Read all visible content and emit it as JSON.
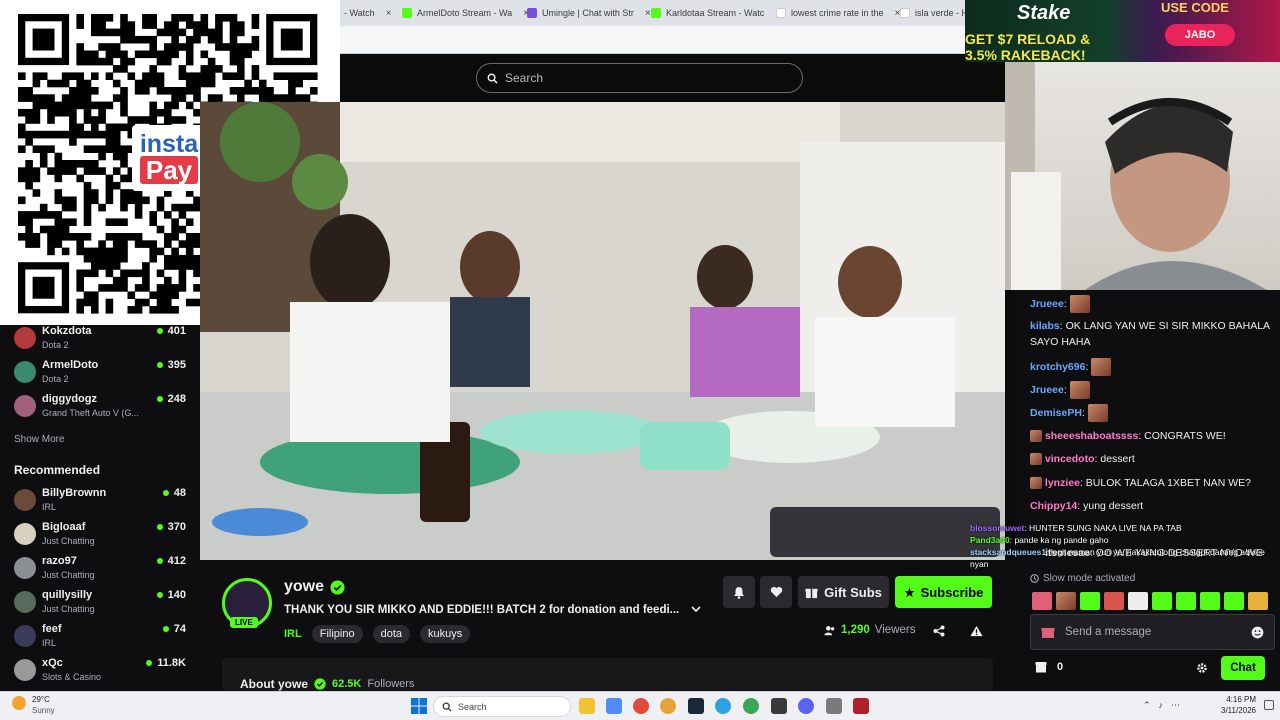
{
  "browser": {
    "tabs": [
      {
        "label": "- Watch",
        "color": "#53fc18"
      },
      {
        "label": "ArmelDoto Stream - Wa",
        "color": "#53fc18"
      },
      {
        "label": "Umingle | Chat with Str",
        "color": "#7a4fd6"
      },
      {
        "label": "Karldotaa Stream - Watc",
        "color": "#53fc18"
      },
      {
        "label": "lowest crime rate in the",
        "color": "#4285f4"
      },
      {
        "label": "isla verde - Ha",
        "color": "#4285f4"
      }
    ],
    "close_glyph": "×"
  },
  "header": {
    "search_placeholder": "Search"
  },
  "qr": {
    "logo_top": "insta",
    "logo_bottom": "Pay"
  },
  "ad": {
    "brand": "Stake",
    "line1": "GET $7 RELOAD &",
    "line2": "3.5% RAKEBACK!",
    "use_code": "USE CODE",
    "code": "JABO"
  },
  "sidebar": {
    "followed": [
      {
        "name": "Kokzdota",
        "game": "Dota 2",
        "viewers": "401",
        "color": "#b33a3a"
      },
      {
        "name": "ArmelDoto",
        "game": "Dota 2",
        "viewers": "395",
        "color": "#3b8a6e"
      },
      {
        "name": "diggydogz",
        "game": "Grand Theft Auto V (G...",
        "viewers": "248",
        "color": "#a2607c"
      }
    ],
    "show_more": "Show More",
    "recommended_title": "Recommended",
    "recommended": [
      {
        "name": "BillyBrownn",
        "game": "IRL",
        "viewers": "48",
        "color": "#6a4a3a"
      },
      {
        "name": "Bigloaaf",
        "game": "Just Chatting",
        "viewers": "370",
        "color": "#d9d0c0"
      },
      {
        "name": "razo97",
        "game": "Just Chatting",
        "viewers": "412",
        "color": "#8a8f94"
      },
      {
        "name": "quillysilly",
        "game": "Just Chatting",
        "viewers": "140",
        "color": "#5a6a5a"
      },
      {
        "name": "feef",
        "game": "IRL",
        "viewers": "74",
        "color": "#3a3a5a"
      },
      {
        "name": "xQc",
        "game": "Slots & Casino",
        "viewers": "11.8K",
        "color": "#9a9a9a"
      }
    ]
  },
  "stream": {
    "channel": "yowe",
    "live_badge": "LIVE",
    "title": "THANK YOU SIR MIKKO AND EDDIE!!! BATCH 2 for donation and feedi...",
    "category": "IRL",
    "tags": [
      "Filipino",
      "dota",
      "kukuys"
    ],
    "viewers": "1,290",
    "viewers_label": "Viewers",
    "gift_subs": "Gift Subs",
    "subscribe": "Subscribe",
    "about": "About yowe",
    "followers": "62.5K",
    "followers_label": "Followers"
  },
  "chat": {
    "messages": [
      {
        "user": "Jrueee",
        "color": "#6aa7ff",
        "text": ""
      },
      {
        "user": "kilabs",
        "color": "#6aa7ff",
        "text": "OK LANG YAN WE SI SIR MIKKO BAHALA SAYO HAHA"
      },
      {
        "user": "krotchy696",
        "color": "#6aa7ff",
        "text": ""
      },
      {
        "user": "Jrueee",
        "color": "#6aa7ff",
        "text": ""
      },
      {
        "user": "DemisePH",
        "color": "#6aa7ff",
        "text": ""
      },
      {
        "user": "sheeeshaboatssss",
        "color": "#ff7acb",
        "text": "CONGRATS WE!"
      },
      {
        "user": "vincedoto",
        "color": "#ff7acb",
        "text": "dessert"
      },
      {
        "user": "lynziee",
        "color": "#ff7acb",
        "text": "BULOK TALAGA 1XBET NAN WE?"
      },
      {
        "user": "Chippy14",
        "color": "#ff7acb",
        "text": "yung dessert"
      },
      {
        "user": "itsmesae",
        "color": "#ffffff",
        "text": "OO WE YUNG DESSERT NYO WE"
      }
    ],
    "overlay": [
      {
        "user": "blossomuwet",
        "text": "HUNTER SUNG NAKA LIVE NA PA TAB"
      },
      {
        "user": "Pand3a40",
        "text": "pande ka ng pande gaho"
      },
      {
        "user": "stacksandqueues1",
        "text": "legit naman yun ye, nakakatulong chatgpt daming advice nyan"
      }
    ],
    "slow_mode": "Slow mode activated",
    "input_placeholder": "Send a message",
    "points": "0",
    "chat_button": "Chat"
  },
  "taskbar": {
    "weather_temp": "29°C",
    "weather_desc": "Sunny",
    "search_label": "Search",
    "time": "4:16 PM",
    "date": "3/11/2026"
  }
}
